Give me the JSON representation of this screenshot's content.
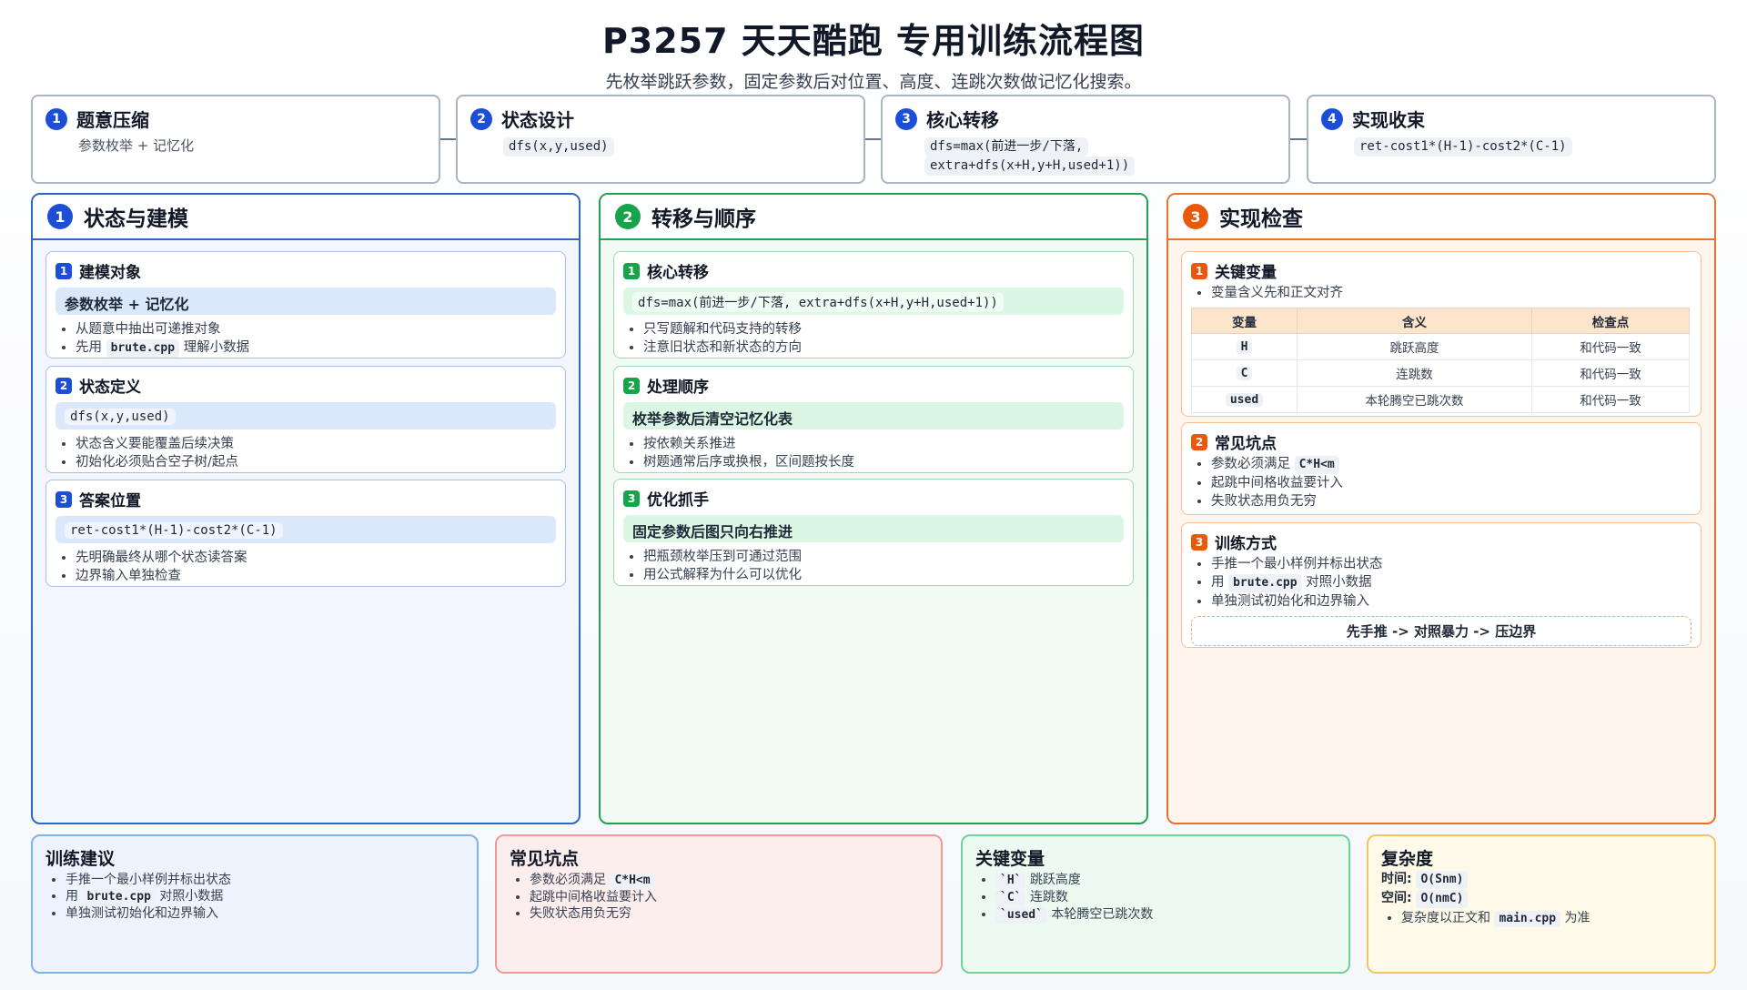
{
  "header": {
    "title": "P3257 天天酷跑 专用训练流程图",
    "subtitle": "先枚举跳跃参数，固定参数后对位置、高度、连跳次数做记忆化搜索。"
  },
  "steps": [
    {
      "num": "1",
      "title": "题意压缩",
      "desc": "参数枚举 + 记忆化"
    },
    {
      "num": "2",
      "title": "状态设计",
      "desc": "dfs(x,y,used)"
    },
    {
      "num": "3",
      "title": "核心转移",
      "desc_line1": "dfs=max(前进一步/下落,",
      "desc_line2": "extra+dfs(x+H,y+H,used+1))"
    },
    {
      "num": "4",
      "title": "实现收束",
      "desc": "ret-cost1*(H-1)-cost2*(C-1)"
    }
  ],
  "col1": {
    "num": "1",
    "title": "状态与建模",
    "cards": [
      {
        "num": "1",
        "title": "建模对象",
        "highlight": "参数枚举 + 记忆化",
        "b1": "从题意中抽出可递推对象",
        "b2_pre": "先用",
        "b2_code": "brute.cpp",
        "b2_post": "理解小数据"
      },
      {
        "num": "2",
        "title": "状态定义",
        "highlight": "dfs(x,y,used)",
        "b1": "状态含义要能覆盖后续决策",
        "b2": "初始化必须贴合空子树/起点"
      },
      {
        "num": "3",
        "title": "答案位置",
        "highlight": "ret-cost1*(H-1)-cost2*(C-1)",
        "b1": "先明确最终从哪个状态读答案",
        "b2": "边界输入单独检查"
      }
    ]
  },
  "col2": {
    "num": "2",
    "title": "转移与顺序",
    "cards": [
      {
        "num": "1",
        "title": "核心转移",
        "highlight": "dfs=max(前进一步/下落, extra+dfs(x+H,y+H,used+1))",
        "b1": "只写题解和代码支持的转移",
        "b2": "注意旧状态和新状态的方向"
      },
      {
        "num": "2",
        "title": "处理顺序",
        "highlight": "枚举参数后清空记忆化表",
        "b1": "按依赖关系推进",
        "b2": "树题通常后序或换根，区间题按长度"
      },
      {
        "num": "3",
        "title": "优化抓手",
        "highlight": "固定参数后图只向右推进",
        "b1": "把瓶颈枚举压到可通过范围",
        "b2": "用公式解释为什么可以优化"
      }
    ]
  },
  "col3": {
    "num": "3",
    "title": "实现检查",
    "card1": {
      "num": "1",
      "title": "关键变量",
      "b1": "变量含义先和正文对齐",
      "table": {
        "headers": [
          "变量",
          "含义",
          "检查点"
        ],
        "rows": [
          [
            "H",
            "跳跃高度",
            "和代码一致"
          ],
          [
            "C",
            "连跳数",
            "和代码一致"
          ],
          [
            "used",
            "本轮腾空已跳次数",
            "和代码一致"
          ]
        ]
      }
    },
    "card2": {
      "num": "2",
      "title": "常见坑点",
      "b1_pre": "参数必须满足",
      "b1_code": "C*H<m",
      "b2": "起跳中间格收益要计入",
      "b3": "失败状态用负无穷"
    },
    "card3": {
      "num": "3",
      "title": "训练方式",
      "b1": "手推一个最小样例并标出状态",
      "b2_pre": "用",
      "b2_code": "brute.cpp",
      "b2_post": "对照小数据",
      "b3": "单独测试初始化和边界输入",
      "flow": "先手推 -> 对照暴力 -> 压边界"
    }
  },
  "bottom": {
    "train": {
      "title": "训练建议",
      "b1": "手推一个最小样例并标出状态",
      "b2_pre": "用",
      "b2_code": "brute.cpp",
      "b2_post": "对照小数据",
      "b3": "单独测试初始化和边界输入"
    },
    "pitfall": {
      "title": "常见坑点",
      "b1_pre": "参数必须满足",
      "b1_code": "C*H<m",
      "b2": "起跳中间格收益要计入",
      "b3": "失败状态用负无穷"
    },
    "vars": {
      "title": "关键变量",
      "v1": "`H`",
      "d1": "跳跃高度",
      "v2": "`C`",
      "d2": "连跳数",
      "v3": "`used`",
      "d3": "本轮腾空已跳次数"
    },
    "complexity": {
      "title": "复杂度",
      "time_label": "时间:",
      "time_val": "O(Snm)",
      "space_label": "空间:",
      "space_val": "O(nmC)",
      "b1_pre": "复杂度以正文和",
      "b1_code": "main.cpp",
      "b1_post": "为准"
    }
  }
}
